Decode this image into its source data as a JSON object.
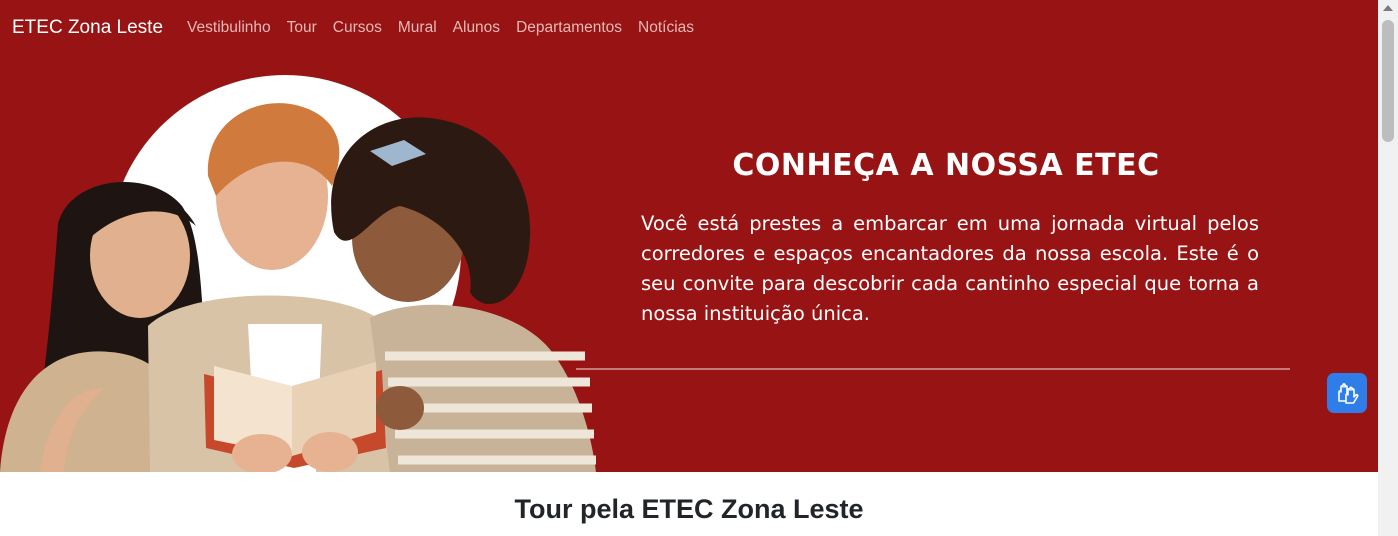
{
  "navbar": {
    "brand": "ETEC Zona Leste",
    "links": [
      "Vestibulinho",
      "Tour",
      "Cursos",
      "Mural",
      "Alunos",
      "Departamentos",
      "Notícias"
    ]
  },
  "hero": {
    "title": "CONHEÇA A NOSSA ETEC",
    "text": "Você está prestes a embarcar em uma jornada virtual pelos corredores e espaços encantadores da nossa escola. Este é o seu convite para descobrir cada cantinho especial que torna a nossa instituição única."
  },
  "section": {
    "title": "Tour pela ETEC Zona Leste"
  },
  "accessibility_button": {
    "icon": "sign-language-hands-icon"
  },
  "colors": {
    "brand_red": "#981313",
    "accent_blue": "#2f7de8",
    "text_dark": "#212529"
  }
}
